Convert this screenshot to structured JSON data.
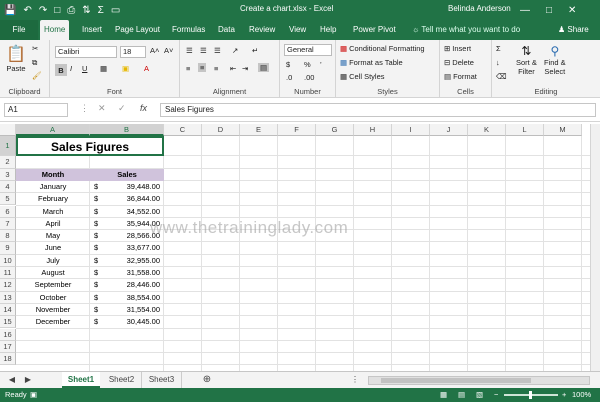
{
  "titlebar": {
    "title": "Create a chart.xlsx  -  Excel",
    "user": "Belinda Anderson",
    "restore": "□",
    "minimize": "—",
    "close": "✕"
  },
  "tabs": [
    "File",
    "Home",
    "Insert",
    "Page Layout",
    "Formulas",
    "Data",
    "Review",
    "View",
    "Help",
    "Power Pivot"
  ],
  "tellme": "Tell me what you want to do",
  "share": "Share",
  "ribbon": {
    "clipboard": {
      "paste": "Paste",
      "label": "Clipboard"
    },
    "font": {
      "name": "Calibri",
      "size": "18",
      "label": "Font",
      "bold": "B",
      "italic": "I",
      "underline": "U",
      "grow": "A˄",
      "shrink": "A˅"
    },
    "alignment": {
      "label": "Alignment"
    },
    "number": {
      "format": "General",
      "currency": "$",
      "percent": "%",
      "comma": "’",
      "label": "Number"
    },
    "styles": {
      "conditional": "Conditional Formatting",
      "table": "Format as Table",
      "cell": "Cell Styles",
      "label": "Styles"
    },
    "cells": {
      "insert": "Insert",
      "delete": "Delete",
      "format": "Format",
      "label": "Cells"
    },
    "editing": {
      "sort1": "Sort &",
      "sort2": "Filter",
      "find1": "Find &",
      "find2": "Select",
      "label": "Editing"
    }
  },
  "formula_bar": {
    "namebox": "A1",
    "fx": "fx",
    "value": "Sales Figures"
  },
  "columns": [
    "A",
    "B",
    "C",
    "D",
    "E",
    "F",
    "G",
    "H",
    "I",
    "J",
    "K",
    "L",
    "M"
  ],
  "rows": [
    "1",
    "2",
    "3",
    "4",
    "5",
    "6",
    "7",
    "8",
    "9",
    "10",
    "11",
    "12",
    "13",
    "14",
    "15",
    "16",
    "17",
    "18"
  ],
  "sheet": {
    "title": "Sales Figures",
    "hdr_month": "Month",
    "hdr_sales": "Sales",
    "data": [
      {
        "month": "January",
        "cur": "$",
        "sales": "39,448.00"
      },
      {
        "month": "February",
        "cur": "$",
        "sales": "36,844.00"
      },
      {
        "month": "March",
        "cur": "$",
        "sales": "34,552.00"
      },
      {
        "month": "April",
        "cur": "$",
        "sales": "35,944.00"
      },
      {
        "month": "May",
        "cur": "$",
        "sales": "28,566.00"
      },
      {
        "month": "June",
        "cur": "$",
        "sales": "33,677.00"
      },
      {
        "month": "July",
        "cur": "$",
        "sales": "32,955.00"
      },
      {
        "month": "August",
        "cur": "$",
        "sales": "31,558.00"
      },
      {
        "month": "September",
        "cur": "$",
        "sales": "28,446.00"
      },
      {
        "month": "October",
        "cur": "$",
        "sales": "38,554.00"
      },
      {
        "month": "November",
        "cur": "$",
        "sales": "31,554.00"
      },
      {
        "month": "December",
        "cur": "$",
        "sales": "30,445.00"
      }
    ]
  },
  "watermark": "www.thetraininglady.com",
  "sheets": [
    "Sheet1",
    "Sheet2",
    "Sheet3"
  ],
  "active_sheet": "Sheet1",
  "status": {
    "ready": "Ready",
    "zoom": "100%"
  },
  "colors": {
    "accent": "#217346",
    "header_fill": "#d0c3dc"
  }
}
